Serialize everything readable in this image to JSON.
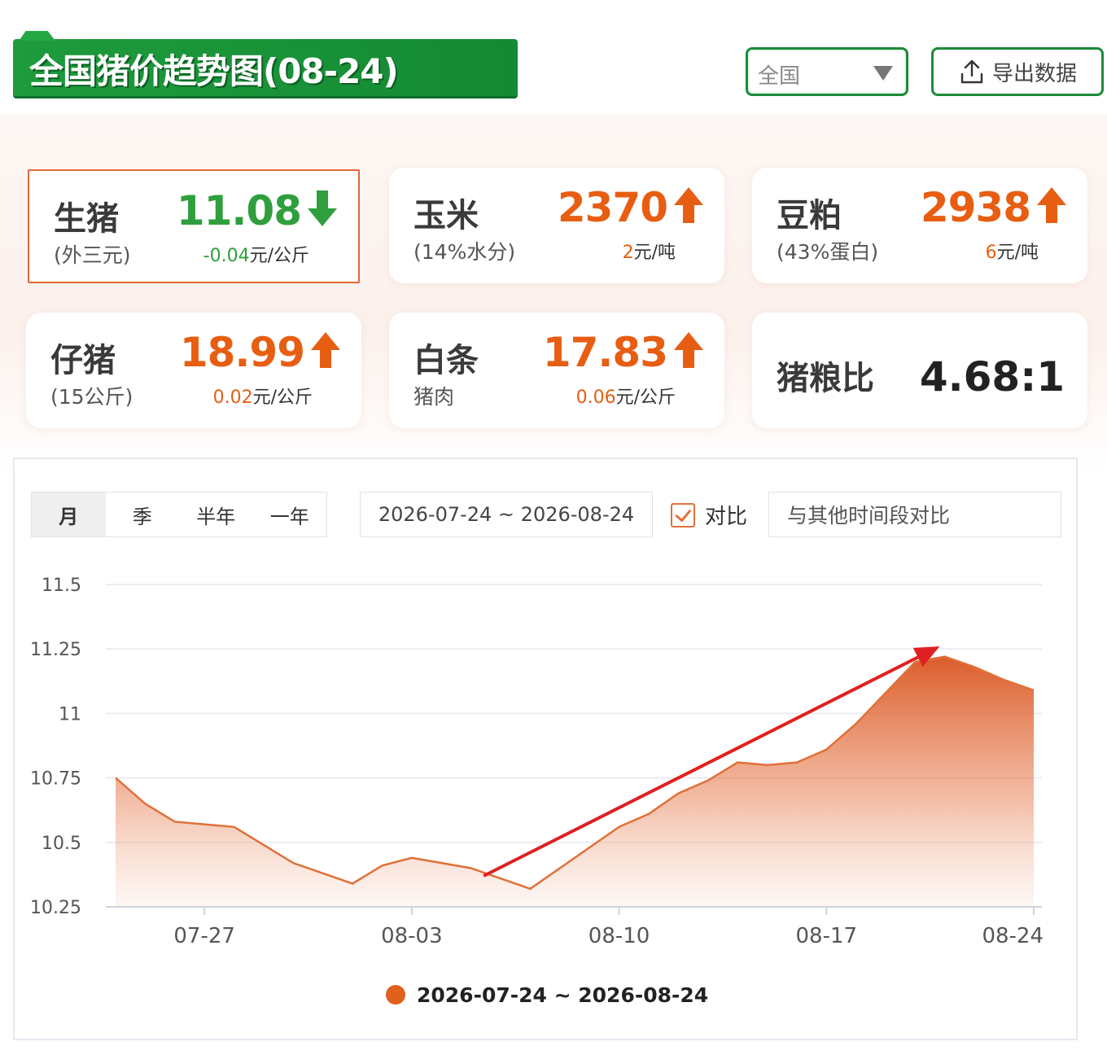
{
  "header": {
    "title": "全国猪价趋势图(08-24)",
    "region_select": "全国",
    "export_label": "导出数据"
  },
  "cards": [
    {
      "name": "生猪",
      "sub": "(外三元)",
      "value": "11.08",
      "direction": "down",
      "change": "-0.04",
      "unit": "元/公斤"
    },
    {
      "name": "玉米",
      "sub": "(14%水分)",
      "value": "2370",
      "direction": "up",
      "change": "2",
      "unit": "元/吨"
    },
    {
      "name": "豆粕",
      "sub": "(43%蛋白)",
      "value": "2938",
      "direction": "up",
      "change": "6",
      "unit": "元/吨"
    },
    {
      "name": "仔猪",
      "sub": "(15公斤)",
      "value": "18.99",
      "direction": "up",
      "change": "0.02",
      "unit": "元/公斤"
    },
    {
      "name": "白条",
      "sub": "猪肉",
      "value": "17.83",
      "direction": "up",
      "change": "0.06",
      "unit": "元/公斤"
    },
    {
      "name": "猪粮比",
      "value": "4.68:1"
    }
  ],
  "controls": {
    "periods": [
      "月",
      "季",
      "半年",
      "一年"
    ],
    "active_period": "月",
    "date_range": "2026-07-24 ~ 2026-08-24",
    "compare_label": "对比",
    "compare_checked": true,
    "compare_placeholder": "与其他时间段对比"
  },
  "colors": {
    "green": "#2f9f3d",
    "orange": "#e75e12",
    "series": "#e07038",
    "trend_arrow": "#e02020"
  },
  "chart_data": {
    "type": "area",
    "x": [
      "07-24",
      "07-25",
      "07-26",
      "07-27",
      "07-28",
      "07-29",
      "07-30",
      "07-31",
      "08-01",
      "08-02",
      "08-03",
      "08-04",
      "08-05",
      "08-06",
      "08-07",
      "08-08",
      "08-09",
      "08-10",
      "08-11",
      "08-12",
      "08-13",
      "08-14",
      "08-15",
      "08-16",
      "08-17",
      "08-18",
      "08-19",
      "08-20",
      "08-21",
      "08-22",
      "08-23",
      "08-24"
    ],
    "series": [
      {
        "name": "2026-07-24 ~ 2026-08-24",
        "values": [
          10.75,
          10.65,
          10.58,
          10.57,
          10.56,
          10.49,
          10.42,
          10.38,
          10.34,
          10.41,
          10.44,
          10.42,
          10.4,
          10.36,
          10.32,
          10.4,
          10.48,
          10.56,
          10.61,
          10.69,
          10.74,
          10.81,
          10.8,
          10.81,
          10.86,
          10.96,
          11.08,
          11.2,
          11.22,
          11.18,
          11.13,
          11.09
        ]
      }
    ],
    "xticks": [
      "07-27",
      "08-03",
      "08-10",
      "08-17",
      "08-24"
    ],
    "yticks": [
      "10.25",
      "10.5",
      "10.75",
      "11",
      "11.25",
      "11.5"
    ],
    "ylim": [
      10.25,
      11.5
    ],
    "grid": true,
    "legend": "bottom-center"
  }
}
